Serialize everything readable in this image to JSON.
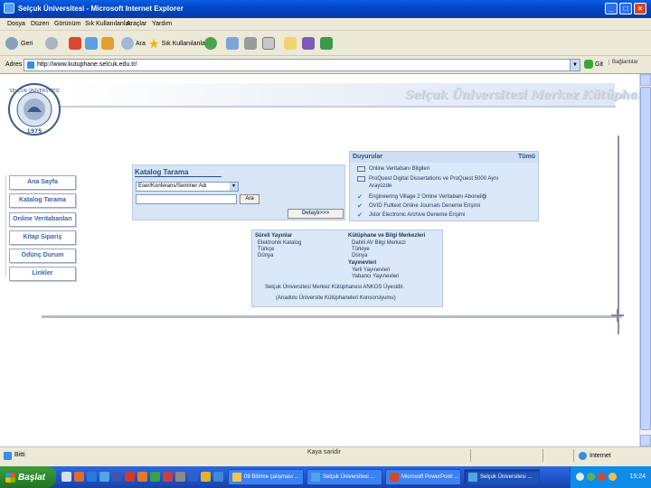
{
  "window": {
    "title": "Selçuk Üniversitesi - Microsoft Internet Explorer"
  },
  "menu": [
    "Dosya",
    "Düzen",
    "Görünüm",
    "Sık Kullanılanlar",
    "Araçlar",
    "Yardım"
  ],
  "toolbar": {
    "back": "Geri",
    "search": "Ara",
    "favorites": "Sık Kullanılanlar"
  },
  "address": {
    "label": "Adres",
    "url": "http://www.kutuphane.selcuk.edu.tr/",
    "go": "Git",
    "links": "Bağlantılar"
  },
  "banner": "Selçuk Üniversitesi Merkez Kütüphanesi",
  "logo": {
    "ring_text": "SELÇUK ÜNİVERSİTESİ",
    "year": "1975"
  },
  "nav": [
    "Ana Sayfa",
    "Katalog Tarama",
    "Online Veritabanları",
    "Kitap Sipariş",
    "Ödünç Durum",
    "Linkler"
  ],
  "catalog": {
    "title": "Katalog Tarama",
    "select_value": "Eser/Konferans/Seminer Adı",
    "search_button": "Ara",
    "detail_button": "Detaylı>>>"
  },
  "announcements": {
    "title": "Duyurular",
    "all": "Tümü",
    "items": [
      "Online Veritabanı Bilgileri",
      "ProQuest Digital Dissertations ve ProQuest 5000 Aynı",
      "Arayüzde",
      "Engineering Village 2 Online Veritabanı Aboneliği",
      "OVID Fulltext Online Journals Deneme Erişimi",
      "Jstor Electronic Archive Deneme Erişimi"
    ]
  },
  "info": {
    "left_head": "Süreli Yayınlar",
    "left_items": [
      "Elektronik Katalog",
      "Türkçe",
      "Dünya"
    ],
    "right_head": "Kütüphane ve Bilgi Merkezleri",
    "right_items": [
      "Dahili AV Bilgi Merkezi",
      "Türkiye",
      "Dünya"
    ],
    "right_head2": "Yayınevleri",
    "right_items2": [
      "Yerli Yayınevleri",
      "Yabancı Yayınevleri"
    ],
    "footer1": "Selçuk Üniversitesi Merkez Kütüphanesi ANKOS Üyesidir.",
    "footer2": "(Anadolu Üniversite Kütüphaneleri Konsorsiyumu)"
  },
  "status": {
    "text": "Bitti",
    "zone": "Internet"
  },
  "caption": "Kaya saridir",
  "taskbar": {
    "start": "Başlat",
    "tasks": [
      "09 Bitirme çalışması ...",
      "Selçuk Üniversitesi ...",
      "Microsoft PowerPoint ...",
      "Selçuk Üniversitesi ..."
    ],
    "clock": "15:24"
  }
}
